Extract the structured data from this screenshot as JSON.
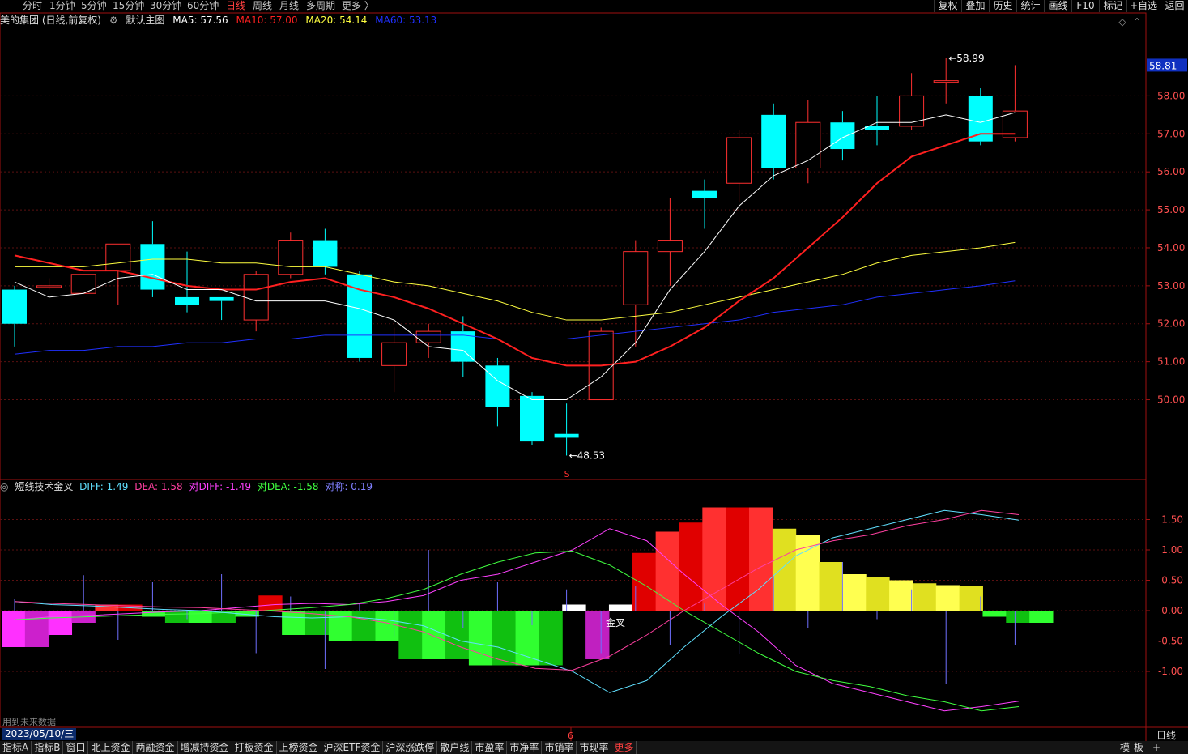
{
  "toolbar": {
    "left_items": [
      "分时",
      "1分钟",
      "5分钟",
      "15分钟",
      "30分钟",
      "60分钟",
      "日线",
      "周线",
      "月线",
      "多周期",
      "更多 〉"
    ],
    "active_index": 6,
    "right_buttons": [
      "复权",
      "叠加",
      "历史",
      "统计",
      "画线",
      "F10",
      "标记",
      "+自选",
      "返回"
    ]
  },
  "main_info": {
    "title": "美的集团 (日线,前复权)",
    "indicator": "默认主图",
    "ma5": "MA5: 57.56",
    "ma10": "MA10: 57.00",
    "ma20": "MA20: 54.14",
    "ma60": "MA60: 53.13"
  },
  "sub_info": {
    "name": "短线技术金叉",
    "diff": "DIFF: 1.49",
    "dea": "DEA: 1.58",
    "ddiff": "对DIFF: -1.49",
    "ddea": "对DEA: -1.58",
    "sym": "对称: 0.19"
  },
  "colors": {
    "up": "#ff3030",
    "down": "#00ffff",
    "ma5": "#ffffff",
    "ma10": "#ff2020",
    "ma20": "#ffff40",
    "ma60": "#2030ff",
    "diff": "#60e0ff",
    "dea": "#ff40a0",
    "ddiff": "#ff40ff",
    "ddea": "#40ff40"
  },
  "chart_data": [
    {
      "type": "candlestick",
      "price_ticks": [
        50.0,
        51.0,
        52.0,
        53.0,
        54.0,
        55.0,
        56.0,
        57.0,
        58.0
      ],
      "ylim": [
        47.9,
        59.8
      ],
      "current_price": "58.81",
      "high_label": "58.99",
      "low_label": "48.53",
      "ohlc": [
        [
          52.9,
          53.0,
          51.4,
          52.0
        ],
        [
          53.0,
          53.2,
          52.9,
          53.0
        ],
        [
          52.8,
          53.3,
          52.8,
          53.3
        ],
        [
          53.4,
          54.1,
          52.5,
          54.1
        ],
        [
          54.1,
          54.7,
          52.7,
          52.9
        ],
        [
          52.7,
          53.9,
          52.3,
          52.5
        ],
        [
          52.7,
          52.7,
          52.1,
          52.6
        ],
        [
          52.1,
          53.4,
          51.8,
          53.3
        ],
        [
          53.3,
          54.4,
          53.2,
          54.2
        ],
        [
          54.2,
          54.5,
          53.3,
          53.5
        ],
        [
          53.3,
          53.4,
          51.0,
          51.1
        ],
        [
          50.9,
          51.9,
          50.2,
          51.5
        ],
        [
          51.5,
          52.0,
          51.1,
          51.8
        ],
        [
          51.8,
          52.2,
          50.6,
          51.0
        ],
        [
          50.9,
          51.1,
          49.3,
          49.8
        ],
        [
          50.1,
          50.2,
          48.8,
          48.9
        ],
        [
          49.1,
          49.9,
          48.53,
          49.0
        ],
        [
          50.0,
          51.9,
          50.0,
          51.8
        ],
        [
          52.5,
          54.2,
          51.4,
          53.9
        ],
        [
          53.9,
          55.3,
          53.0,
          54.2
        ],
        [
          55.5,
          55.8,
          54.5,
          55.3
        ],
        [
          55.7,
          57.1,
          55.2,
          56.9
        ],
        [
          57.5,
          57.8,
          55.8,
          56.1
        ],
        [
          56.1,
          57.9,
          55.7,
          57.3
        ],
        [
          57.3,
          57.6,
          56.3,
          56.6
        ],
        [
          57.2,
          58.0,
          56.7,
          57.1
        ],
        [
          57.2,
          58.6,
          57.1,
          58.0
        ],
        [
          58.4,
          58.99,
          57.8,
          58.4
        ],
        [
          58.0,
          58.2,
          56.7,
          56.8
        ],
        [
          56.9,
          58.81,
          56.8,
          57.6
        ]
      ],
      "ma5": [
        53.1,
        52.7,
        52.8,
        53.2,
        53.3,
        52.9,
        52.9,
        52.6,
        52.6,
        52.6,
        52.4,
        52.1,
        51.4,
        51.3,
        50.5,
        50.0,
        50.0,
        50.6,
        51.5,
        52.9,
        53.9,
        55.1,
        55.9,
        56.3,
        56.9,
        57.3,
        57.3,
        57.5,
        57.3,
        57.56
      ],
      "ma10": [
        53.8,
        53.6,
        53.4,
        53.4,
        53.2,
        53.0,
        52.9,
        52.9,
        53.1,
        53.2,
        52.9,
        52.7,
        52.4,
        52.0,
        51.6,
        51.1,
        50.9,
        50.9,
        51.0,
        51.4,
        51.9,
        52.6,
        53.2,
        54.0,
        54.8,
        55.7,
        56.4,
        56.7,
        57.0,
        57.0
      ],
      "ma20": [
        53.5,
        53.5,
        53.5,
        53.6,
        53.7,
        53.7,
        53.6,
        53.6,
        53.5,
        53.5,
        53.3,
        53.1,
        53.0,
        52.8,
        52.6,
        52.3,
        52.1,
        52.1,
        52.2,
        52.3,
        52.5,
        52.7,
        52.9,
        53.1,
        53.3,
        53.6,
        53.8,
        53.9,
        54.0,
        54.14
      ],
      "ma60": [
        51.2,
        51.3,
        51.3,
        51.4,
        51.4,
        51.5,
        51.5,
        51.6,
        51.6,
        51.7,
        51.7,
        51.7,
        51.7,
        51.7,
        51.6,
        51.6,
        51.6,
        51.7,
        51.8,
        51.9,
        52.0,
        52.1,
        52.3,
        52.4,
        52.5,
        52.7,
        52.8,
        52.9,
        53.0,
        53.13
      ]
    },
    {
      "type": "bar",
      "sub_ticks": [
        1.5,
        1.0,
        0.5,
        0.0,
        -0.5,
        -1.0
      ],
      "ylim": [
        -1.92,
        1.92
      ],
      "hist": [
        -0.6,
        -0.6,
        -0.4,
        -0.2,
        0.1,
        0.1,
        -0.1,
        -0.2,
        -0.2,
        -0.2,
        -0.1,
        0.25,
        -0.4,
        -0.4,
        -0.5,
        -0.5,
        -0.5,
        -0.8,
        -0.8,
        -0.8,
        -0.9,
        -0.9,
        -0.9,
        -0.9,
        0.1,
        -0.8,
        0.1,
        0.95,
        1.3,
        1.45,
        1.7,
        1.7,
        1.7,
        1.35,
        1.25,
        0.8,
        0.6,
        0.55,
        0.5,
        0.45,
        0.42,
        0.4,
        -0.1,
        -0.2,
        -0.2
      ],
      "hist_mark": [
        0,
        0,
        0,
        0,
        1,
        1,
        2,
        2,
        2,
        2,
        2,
        1,
        2,
        2,
        2,
        2,
        2,
        2,
        2,
        2,
        2,
        2,
        2,
        2,
        3,
        4,
        3,
        1,
        1,
        1,
        1,
        1,
        1,
        5,
        5,
        5,
        5,
        5,
        5,
        5,
        5,
        5,
        2,
        2,
        2
      ],
      "diff": [
        0.15,
        0.1,
        0.08,
        0.05,
        0.02,
        0.0,
        -0.05,
        -0.1,
        -0.12,
        -0.1,
        -0.15,
        -0.25,
        -0.5,
        -0.6,
        -0.8,
        -1.0,
        -1.35,
        -1.15,
        -0.6,
        -0.1,
        0.35,
        0.9,
        1.2,
        1.35,
        1.5,
        1.65,
        1.58,
        1.49
      ],
      "dea": [
        0.15,
        0.12,
        0.1,
        0.08,
        0.06,
        0.05,
        0.02,
        -0.01,
        -0.05,
        -0.1,
        -0.2,
        -0.35,
        -0.6,
        -0.8,
        -0.95,
        -0.98,
        -0.75,
        -0.4,
        0.0,
        0.35,
        0.7,
        1.0,
        1.15,
        1.25,
        1.4,
        1.5,
        1.65,
        1.58
      ],
      "ddiff": [
        -0.15,
        -0.1,
        -0.08,
        -0.05,
        -0.02,
        0.0,
        0.05,
        0.1,
        0.12,
        0.1,
        0.15,
        0.25,
        0.5,
        0.6,
        0.8,
        1.0,
        1.35,
        1.15,
        0.6,
        0.1,
        -0.35,
        -0.9,
        -1.2,
        -1.35,
        -1.5,
        -1.65,
        -1.58,
        -1.49
      ],
      "ddea": [
        -0.15,
        -0.12,
        -0.1,
        -0.08,
        -0.06,
        -0.05,
        -0.02,
        0.01,
        0.05,
        0.1,
        0.2,
        0.35,
        0.6,
        0.8,
        0.95,
        0.98,
        0.75,
        0.4,
        0.0,
        -0.35,
        -0.7,
        -1.0,
        -1.15,
        -1.25,
        -1.4,
        -1.5,
        -1.65,
        -1.58
      ],
      "golden_cross_label": "金叉"
    }
  ],
  "footer": {
    "date": "2023/05/10/三",
    "note": "用到未来数据",
    "tabs": [
      "指标A",
      "指标B",
      "窗口",
      "北上资金",
      "两融资金",
      "增减持资金",
      "打板资金",
      "上榜资金",
      "沪深ETF资金",
      "沪深涨跌停",
      "散户线",
      "市盈率",
      "市净率",
      "市销率",
      "市现率"
    ],
    "more": "更多",
    "right": [
      "模",
      "板",
      "+",
      "-"
    ],
    "period": "日线",
    "cursor_mark": "6",
    "signal": "S"
  }
}
